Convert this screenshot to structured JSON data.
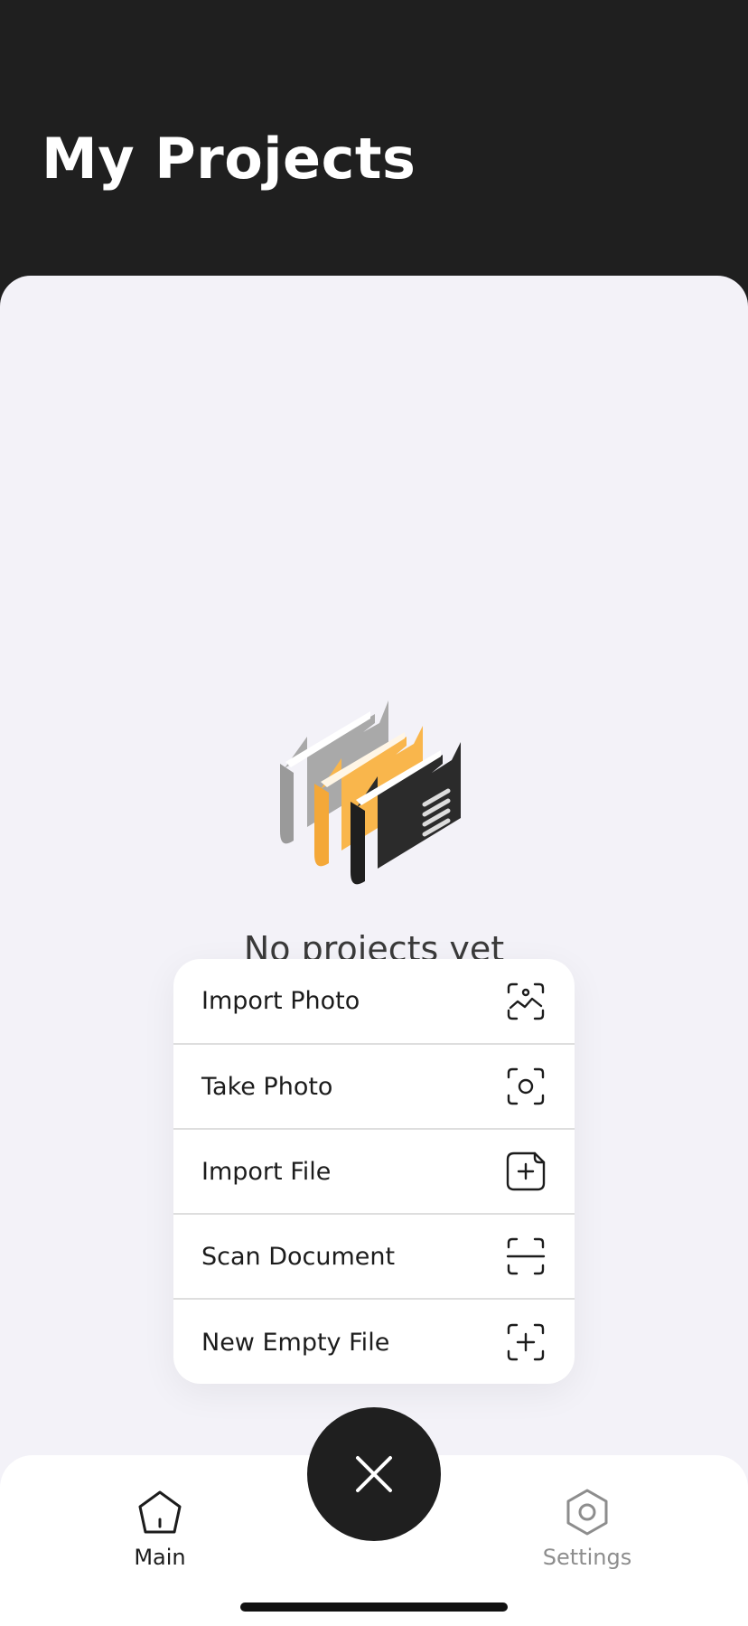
{
  "header": {
    "title": "My Projects"
  },
  "empty_state": {
    "message": "No projects yet",
    "illustration": "folders-illustration"
  },
  "menu": {
    "items": [
      {
        "label": "Import Photo",
        "icon": "image-frame-icon"
      },
      {
        "label": "Take Photo",
        "icon": "camera-frame-icon"
      },
      {
        "label": "Import File",
        "icon": "file-plus-icon"
      },
      {
        "label": "Scan Document",
        "icon": "scan-icon"
      },
      {
        "label": "New Empty File",
        "icon": "frame-plus-icon"
      }
    ]
  },
  "fab": {
    "icon": "close-icon"
  },
  "tabbar": {
    "items": [
      {
        "label": "Main",
        "icon": "home-icon",
        "active": true
      },
      {
        "label": "Settings",
        "icon": "hexagon-gear-icon",
        "active": false
      }
    ]
  },
  "colors": {
    "header_bg": "#1f1f1f",
    "content_bg": "#f3f2f8",
    "accent_yellow": "#f9b64c",
    "text_dark": "#1c1c1c",
    "tab_inactive": "#8d8d8d"
  }
}
